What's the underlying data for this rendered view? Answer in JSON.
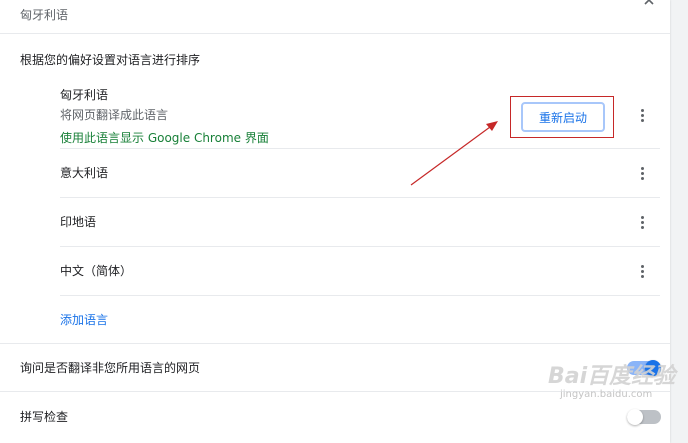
{
  "top_section": {
    "title": "匈牙利语"
  },
  "sort_heading": "根据您的偏好设置对语言进行排序",
  "languages": [
    {
      "name": "匈牙利语",
      "subtitle": "将网页翻译成此语言",
      "display_note": "使用此语言显示 Google Chrome 界面",
      "restart_label": "重新启动"
    },
    {
      "name": "意大利语"
    },
    {
      "name": "印地语"
    },
    {
      "name": "中文（简体）"
    }
  ],
  "add_language_label": "添加语言",
  "translate_offer": {
    "label": "询问是否翻译非您所用语言的网页",
    "enabled": true
  },
  "spell_check": {
    "label": "拼写检查",
    "enabled": false
  },
  "watermark": {
    "logo": "Bai百度经验",
    "sub": "jingyan.baidu.com"
  },
  "colors": {
    "accent": "#1a73e8",
    "green": "#188038",
    "annotation_red": "#c62828",
    "toggle_on_track": "#8ab4f8",
    "toggle_off_track": "#bdc1c6"
  }
}
